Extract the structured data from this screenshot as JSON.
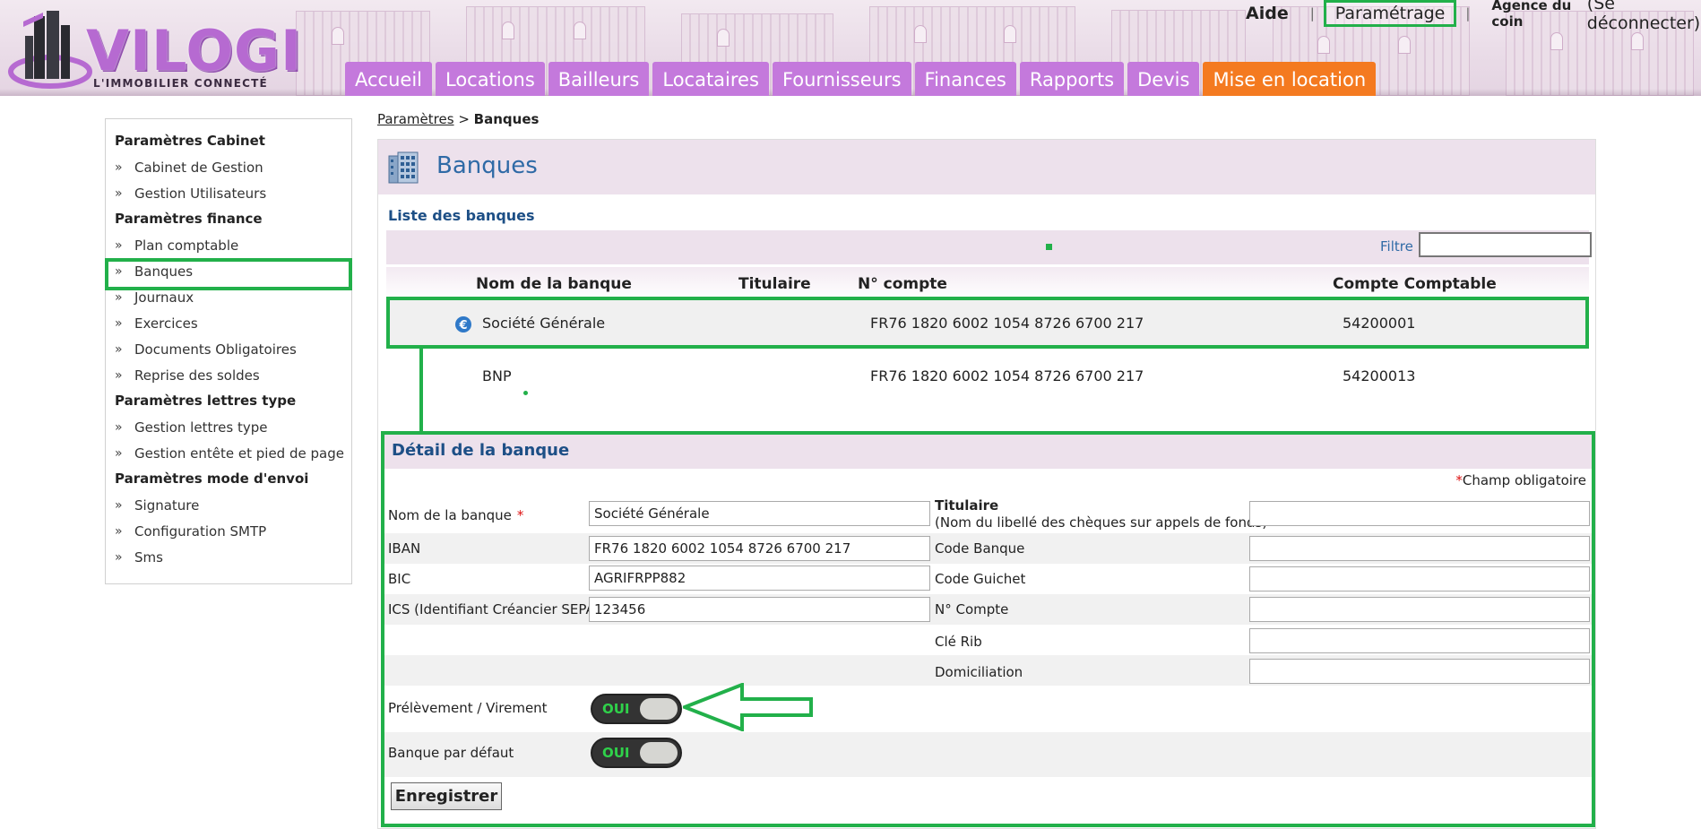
{
  "header": {
    "logo_text": "VILOGI",
    "logo_tagline": "L'IMMOBILIER CONNECTÉ",
    "links": {
      "aide": "Aide",
      "sep1": "|",
      "parametrage": "Paramétrage",
      "sep2": "|",
      "agency": "Agence du coin",
      "logout": "(Se déconnecter)"
    },
    "nav": [
      {
        "label": "Accueil"
      },
      {
        "label": "Locations"
      },
      {
        "label": "Bailleurs"
      },
      {
        "label": "Locataires"
      },
      {
        "label": "Fournisseurs"
      },
      {
        "label": "Finances"
      },
      {
        "label": "Rapports"
      },
      {
        "label": "Devis"
      },
      {
        "label": "Mise en location"
      }
    ]
  },
  "sidebar": {
    "sections": [
      {
        "title": "Paramètres Cabinet",
        "items": [
          "Cabinet de Gestion",
          "Gestion Utilisateurs"
        ]
      },
      {
        "title": "Paramètres finance",
        "items": [
          "Plan comptable",
          "Banques",
          "Journaux",
          "Exercices",
          "Documents Obligatoires",
          "Reprise des soldes"
        ]
      },
      {
        "title": "Paramètres lettres type",
        "items": [
          "Gestion lettres type",
          "Gestion entête et pied de page"
        ]
      },
      {
        "title": "Paramètres mode d'envoi",
        "items": [
          "Signature",
          "Configuration SMTP",
          "Sms"
        ]
      }
    ],
    "chevron": "»"
  },
  "breadcrumb": {
    "parent": "Paramètres",
    "sep": ">",
    "current": "Banques"
  },
  "panel": {
    "title": "Banques",
    "list_title": "Liste des banques",
    "filter_label": "Filtre",
    "columns": [
      "Nom de la banque",
      "Titulaire",
      "N° compte",
      "Compte Comptable"
    ],
    "rows": [
      {
        "name": "Société Générale",
        "titulaire": "",
        "compte": "FR76 1820 6002 1054 8726 6700 217",
        "comptable": "54200001"
      },
      {
        "name": "BNP",
        "titulaire": "",
        "compte": "FR76 1820 6002 1054 8726 6700 217",
        "comptable": "54200013"
      }
    ]
  },
  "detail": {
    "title": "Détail de la banque",
    "required_note": "Champ obligatoire",
    "required_star": "*",
    "fields": {
      "nom_label": "Nom de la banque",
      "nom_value": "Société Générale",
      "iban_label": "IBAN",
      "iban_value": "FR76 1820 6002 1054 8726 6700 217",
      "bic_label": "BIC",
      "bic_value": "AGRIFRPP882",
      "ics_label": "ICS (Identifiant Créancier SEPA)",
      "ics_value": "123456",
      "titulaire_label": "Titulaire",
      "titulaire_sub": "(Nom du libellé des chèques sur appels de fonds)",
      "code_banque_label": "Code Banque",
      "code_guichet_label": "Code Guichet",
      "no_compte_label": "N° Compte",
      "cle_rib_label": "Clé Rib",
      "domiciliation_label": "Domiciliation"
    },
    "prelevement_label": "Prélèvement / Virement",
    "prelevement_toggle": "OUI",
    "defaut_label": "Banque par défaut",
    "defaut_toggle": "OUI",
    "save_label": "Enregistrer"
  }
}
